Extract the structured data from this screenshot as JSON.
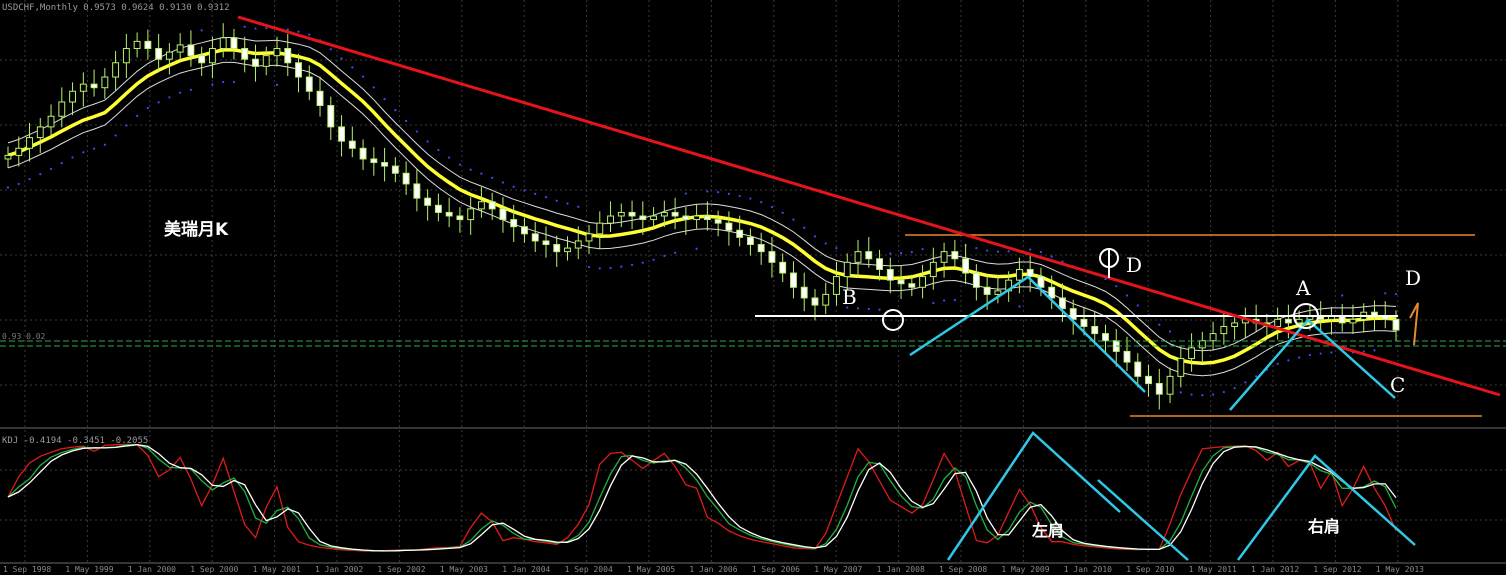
{
  "chart_data": {
    "type": "candlestick",
    "symbol_info": "USDCHF,Monthly  0.9573 0.9624 0.9130 0.9312",
    "price_title": "美瑞月K",
    "indicator_info": "KDJ -0.4194 -0.3451 -0.2055",
    "price_readout": "0.93 0.02",
    "x_labels": [
      "1 Sep 1998",
      "1 May 1999",
      "1 Jan 2000",
      "1 Sep 2000",
      "1 May 2001",
      "1 Jan 2002",
      "1 Sep 2002",
      "1 May 2003",
      "1 Jan 2004",
      "1 Sep 2004",
      "1 May 2005",
      "1 Jan 2006",
      "1 Sep 2006",
      "1 May 2007",
      "1 Jan 2008",
      "1 Sep 2008",
      "1 May 2009",
      "1 Jan 2010",
      "1 Sep 2010",
      "1 May 2011",
      "1 Jan 2012",
      "1 Sep 2012",
      "1 May 2013"
    ],
    "close_series": [
      1.42,
      1.44,
      1.47,
      1.5,
      1.53,
      1.57,
      1.6,
      1.62,
      1.61,
      1.64,
      1.68,
      1.72,
      1.74,
      1.72,
      1.69,
      1.71,
      1.73,
      1.7,
      1.68,
      1.72,
      1.75,
      1.72,
      1.69,
      1.67,
      1.7,
      1.72,
      1.68,
      1.64,
      1.6,
      1.56,
      1.5,
      1.46,
      1.44,
      1.41,
      1.4,
      1.39,
      1.37,
      1.34,
      1.3,
      1.28,
      1.26,
      1.25,
      1.24,
      1.27,
      1.29,
      1.27,
      1.24,
      1.22,
      1.2,
      1.18,
      1.17,
      1.15,
      1.16,
      1.18,
      1.2,
      1.23,
      1.25,
      1.26,
      1.25,
      1.24,
      1.25,
      1.26,
      1.25,
      1.24,
      1.25,
      1.24,
      1.23,
      1.21,
      1.19,
      1.17,
      1.15,
      1.12,
      1.09,
      1.05,
      1.02,
      1.0,
      1.03,
      1.08,
      1.12,
      1.15,
      1.13,
      1.1,
      1.07,
      1.06,
      1.05,
      1.08,
      1.12,
      1.15,
      1.13,
      1.09,
      1.05,
      1.03,
      1.04,
      1.07,
      1.1,
      1.08,
      1.05,
      1.02,
      0.99,
      0.96,
      0.94,
      0.92,
      0.9,
      0.87,
      0.84,
      0.8,
      0.78,
      0.75,
      0.8,
      0.85,
      0.88,
      0.9,
      0.92,
      0.94,
      0.95,
      0.96,
      0.95,
      0.94,
      0.96,
      0.95,
      0.96,
      0.97,
      0.96,
      0.97,
      0.95,
      0.96,
      0.98,
      0.97,
      0.96,
      0.93
    ],
    "annotations": [
      "B",
      "D",
      "A",
      "D",
      "C",
      "左肩",
      "右肩"
    ]
  }
}
